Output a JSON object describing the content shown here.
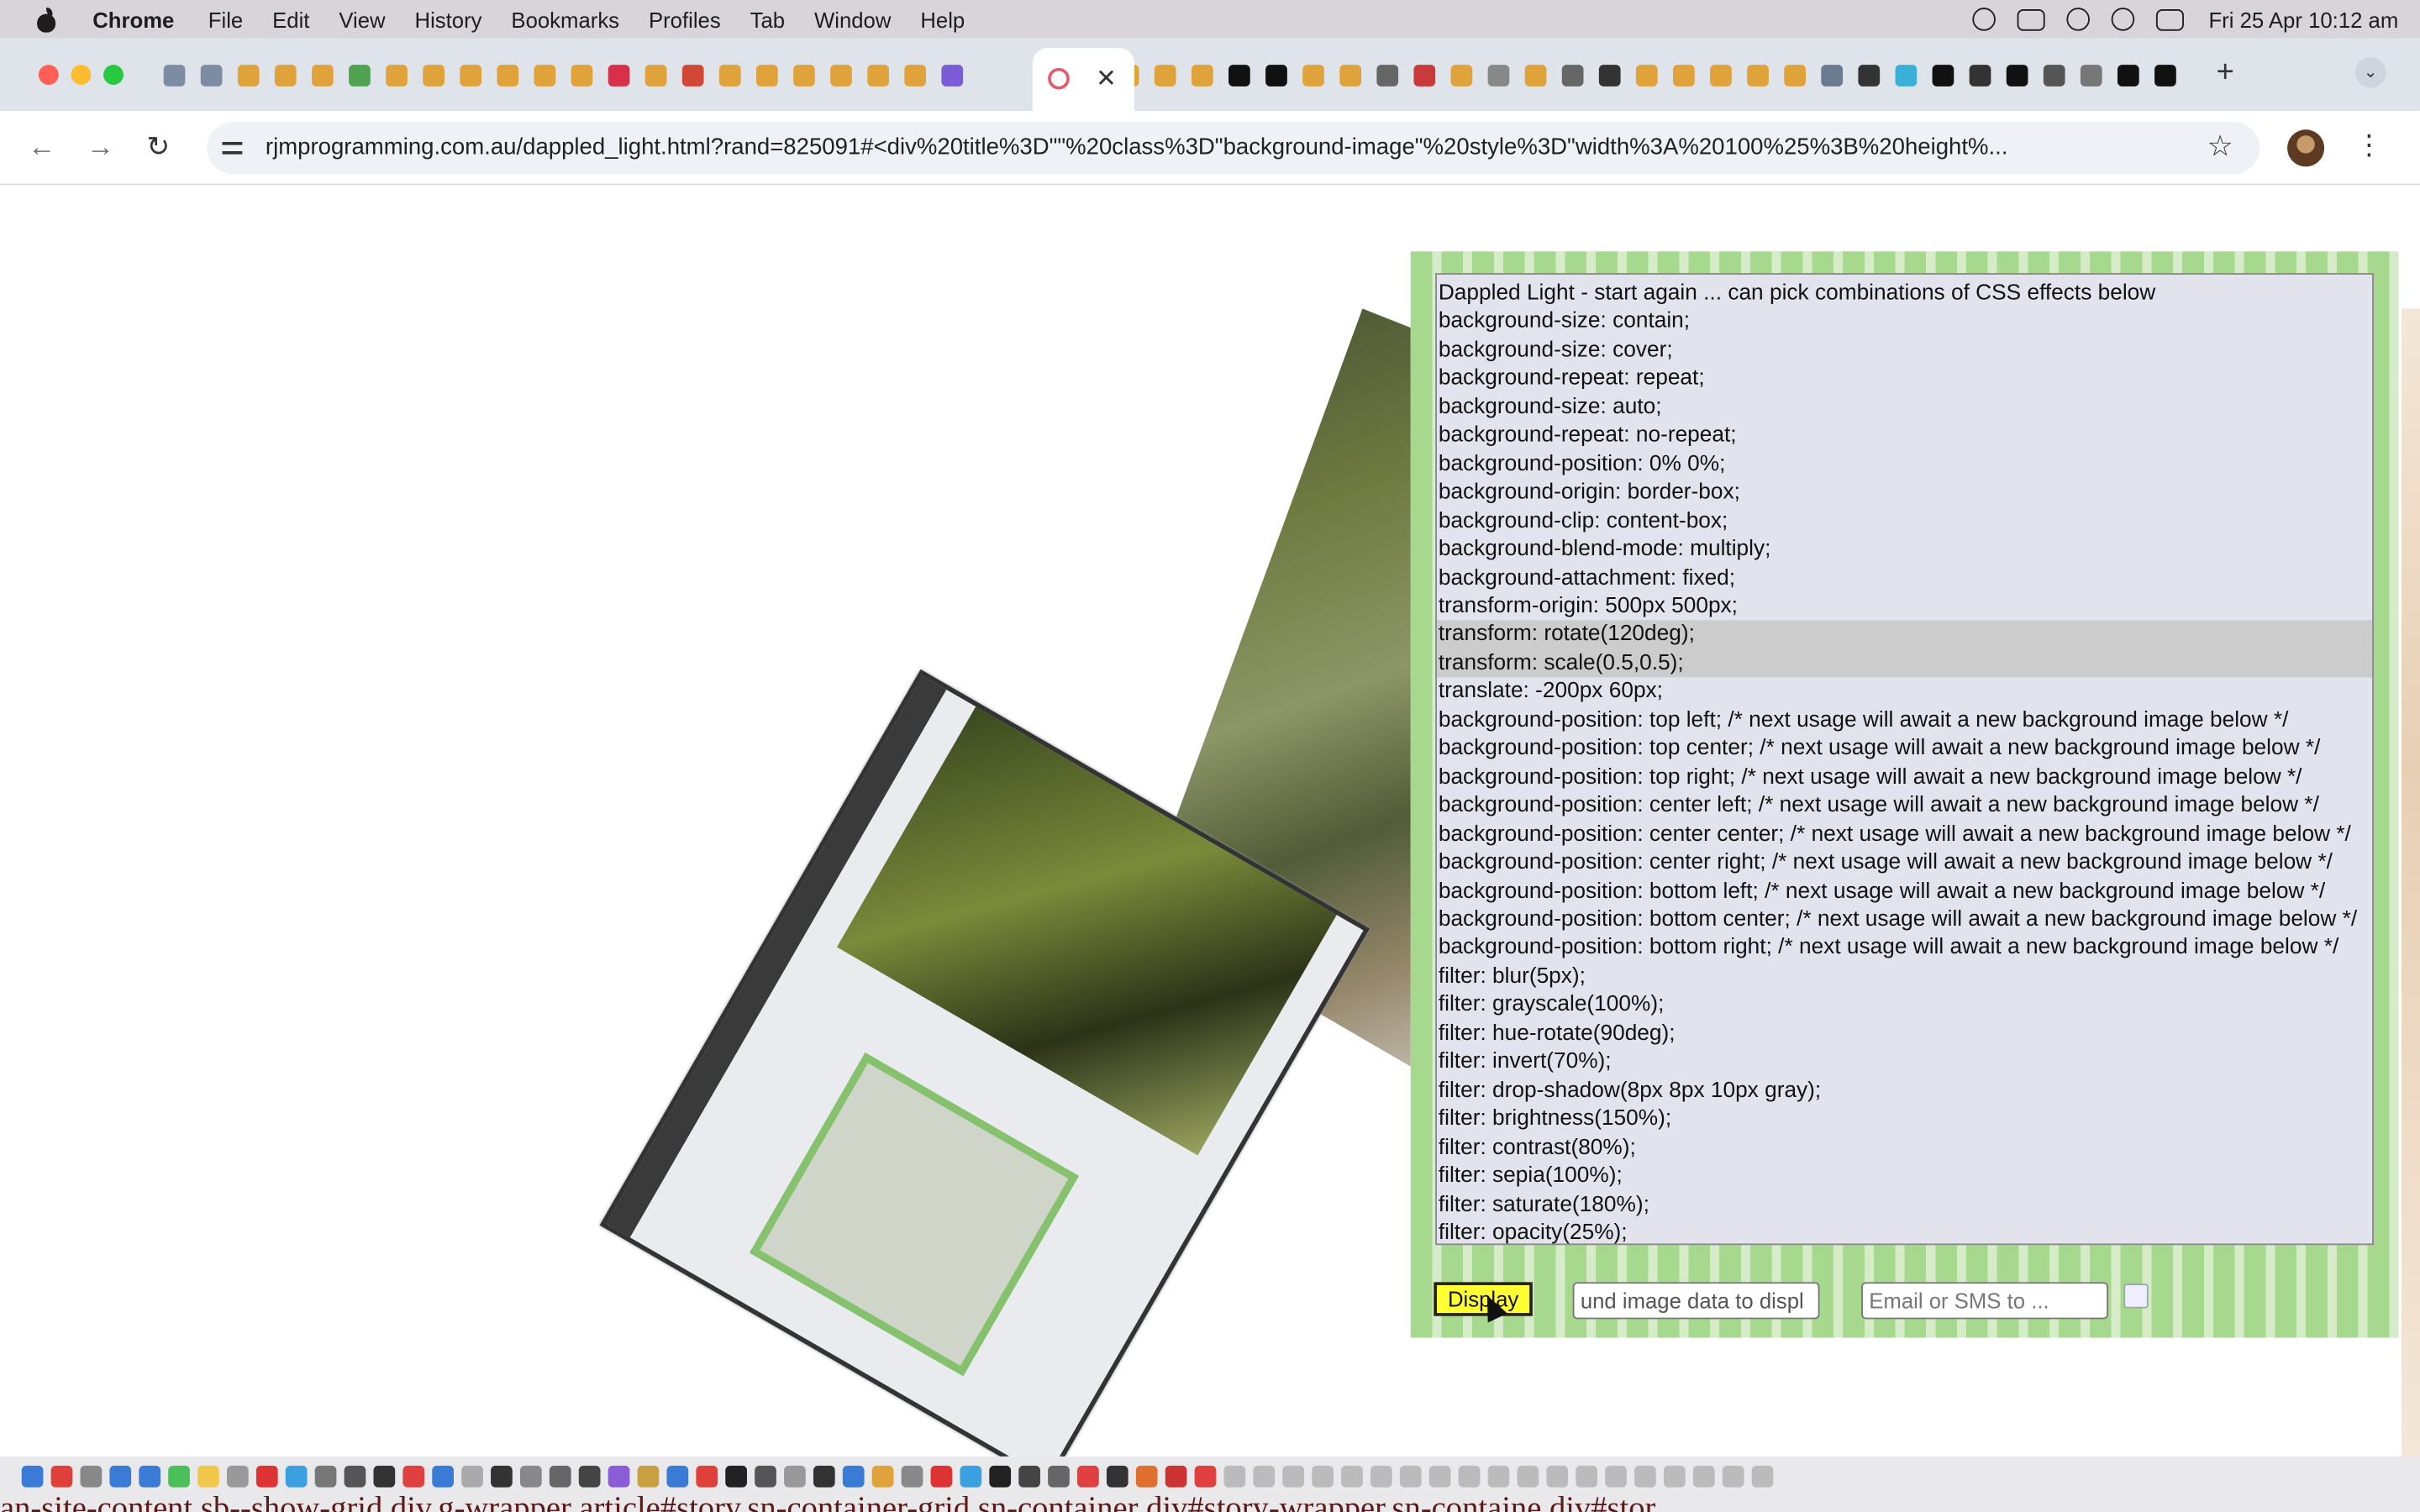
{
  "menubar": {
    "app_name": "Chrome",
    "menus": [
      "File",
      "Edit",
      "View",
      "History",
      "Bookmarks",
      "Profiles",
      "Tab",
      "Window",
      "Help"
    ],
    "clock": "Fri 25 Apr  10:12 am"
  },
  "browser": {
    "tab_close": "✕",
    "new_tab": "+",
    "tab_list": "⌄",
    "url": "rjmprogramming.com.au/dappled_light.html?rand=825091#<div%20title%3D\"\"%20class%3D\"background-image\"%20style%3D\"width%3A%20100%25%3B%20height%...",
    "back": "←",
    "forward": "→",
    "reload": "↻",
    "star": "☆",
    "menu": "⋮"
  },
  "colors": {
    "tab_icons": [
      "#7c8da3",
      "#7c8da3",
      "#e0a23a",
      "#e0a23a",
      "#e0a23a",
      "#4fa24f",
      "#e0a23a",
      "#e0a23a",
      "#e0a23a",
      "#e0a23a",
      "#e0a23a",
      "#e0a23a",
      "#d9304a",
      "#e0a23a",
      "#d14836",
      "#e0a23a",
      "#e0a23a",
      "#e0a23a",
      "#e0a23a",
      "#e0a23a",
      "#e0a23a",
      "#7b5bd6"
    ],
    "tab_icons_right": [
      "#e0a23a",
      "#e0a23a",
      "#e0a23a",
      "#111111",
      "#111111",
      "#e0a23a",
      "#e0a23a",
      "#666666",
      "#c93a3a",
      "#e0a23a",
      "#888888",
      "#e0a23a",
      "#666666",
      "#333333",
      "#e0a23a",
      "#e0a23a",
      "#e0a23a",
      "#e0a23a",
      "#e0a23a",
      "#6a7b90",
      "#333333",
      "#3ab0d9",
      "#111111",
      "#333333",
      "#111111",
      "#555555",
      "#777777",
      "#111111",
      "#111111"
    ],
    "dock_apps": [
      "#3a7bd5",
      "#e0403a",
      "#888",
      "#3a7bd5",
      "#3a7bd5",
      "#4bc05a",
      "#f2c84b",
      "#999",
      "#d33",
      "#3aa0e0",
      "#777",
      "#555",
      "#333",
      "#e04040",
      "#3a7bd5",
      "#aaa",
      "#333",
      "#888",
      "#666",
      "#444",
      "#8a5cd6",
      "#c9a040",
      "#3a7bd5",
      "#e0403a",
      "#222",
      "#555",
      "#999",
      "#333",
      "#3a7bd5",
      "#e0a23a",
      "#888",
      "#d33",
      "#3aa0e0",
      "#222",
      "#444",
      "#666",
      "#e04040",
      "#333",
      "#e07030",
      "#c33",
      "#e04040",
      "#bbb",
      "#bbb",
      "#bbb",
      "#bbb",
      "#bbb",
      "#bbb",
      "#bbb",
      "#bbb",
      "#bbb",
      "#bbb",
      "#bbb",
      "#bbb",
      "#bbb",
      "#bbb",
      "#bbb",
      "#bbb",
      "#bbb",
      "#bbb",
      "#bbb"
    ]
  },
  "panel": {
    "effects": [
      "Dappled Light - start again ... can pick combinations of CSS effects below",
      "background-size: contain;",
      "background-size: cover;",
      "background-repeat: repeat;",
      "background-size: auto;",
      "background-repeat: no-repeat;",
      "background-position: 0% 0%;",
      "background-origin: border-box;",
      "background-clip: content-box;",
      "background-blend-mode: multiply;",
      "background-attachment: fixed;",
      "transform-origin: 500px 500px;",
      "transform: rotate(120deg);",
      "transform: scale(0.5,0.5);",
      "translate: -200px 60px;",
      "background-position: top left; /* next usage will await a new background image below */",
      "background-position: top center; /* next usage will await a new background image below */",
      "background-position: top right; /* next usage will await a new background image below */",
      "background-position: center left; /* next usage will await a new background image below */",
      "background-position: center center; /* next usage will await a new background image below */",
      "background-position: center right; /* next usage will await a new background image below */",
      "background-position: bottom left; /* next usage will await a new background image below */",
      "background-position: bottom center; /* next usage will await a new background image below */",
      "background-position: bottom right; /* next usage will await a new background image below */",
      "filter: blur(5px);",
      "filter: grayscale(100%);",
      "filter: hue-rotate(90deg);",
      "filter: invert(70%);",
      "filter: drop-shadow(8px 8px 10px gray);",
      "filter: brightness(150%);",
      "filter: contrast(80%);",
      "filter: sepia(100%);",
      "filter: saturate(180%);",
      "filter: opacity(25%);"
    ],
    "selected_indices": [
      12,
      13
    ],
    "display_label": "Display",
    "bg_data_value": "und image data to displ",
    "email_placeholder": "Email or SMS to ..."
  },
  "background_text": "an-site-content.sb--show-grid   div.g-wrapper   article#story.sn-container-grid.sn-container   div#story-wrapper.sn-containe   div#stor"
}
